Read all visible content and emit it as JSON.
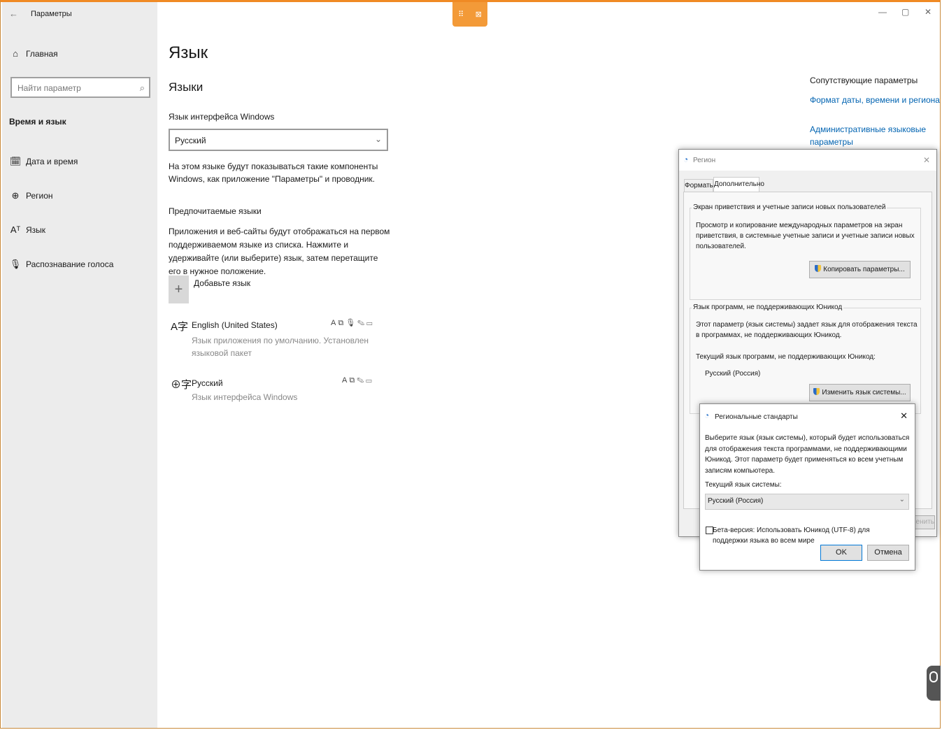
{
  "window": {
    "title": "Параметры",
    "back_glyph": "←",
    "minimize": "—",
    "maximize": "▢",
    "close": "✕"
  },
  "sidebar": {
    "home": "Главная",
    "search_placeholder": "Найти параметр",
    "section": "Время и язык",
    "items": [
      {
        "label": "Дата и время",
        "icon": "calendar-clock-icon",
        "glyph": "🗓"
      },
      {
        "label": "Регион",
        "icon": "globe-icon",
        "glyph": "⊕"
      },
      {
        "label": "Язык",
        "icon": "language-icon",
        "glyph": "Aᵀ"
      },
      {
        "label": "Распознавание голоса",
        "icon": "microphone-icon",
        "glyph": "🎙"
      }
    ]
  },
  "main": {
    "title": "Язык",
    "subtitle": "Языки",
    "interface_label": "Язык интерфейса Windows",
    "interface_value": "Русский",
    "interface_desc": "На этом языке будут показываться такие компоненты Windows, как приложение \"Параметры\" и проводник.",
    "preferred_label": "Предпочитаемые языки",
    "preferred_desc": "Приложения и веб-сайты будут отображаться на первом поддерживаемом языке из списка. Нажмите и удерживайте (или выберите) язык, затем перетащите его в нужное положение.",
    "add_language": "Добавьте язык",
    "languages": [
      {
        "name": "English (United States)",
        "desc": "Язык приложения по умолчанию. Установлен языковой пакет"
      },
      {
        "name": "Русский",
        "desc": "Язык интерфейса Windows"
      }
    ]
  },
  "related": {
    "title": "Сопутствующие параметры",
    "link1": "Формат даты, времени и региона",
    "link2": "Административные языковые параметры"
  },
  "region_dialog": {
    "title": "Регион",
    "tabs": [
      "Форматы",
      "Дополнительно"
    ],
    "group1_title": "Экран приветствия и учетные записи новых пользователей",
    "group1_text": "Просмотр и копирование международных параметров на экран приветствия, в системные учетные записи и учетные записи новых пользователей.",
    "copy_button": "Копировать параметры...",
    "group2_title": "Язык программ, не поддерживающих Юникод",
    "group2_text": "Этот параметр (язык системы) задает язык для отображения текста в программах, не поддерживающих Юникод.",
    "current_label": "Текущий язык программ, не поддерживающих Юникод:",
    "current_value": "Русский (Россия)",
    "change_button": "Изменить язык системы...",
    "apply_partial": "енить"
  },
  "regional_dialog": {
    "title": "Региональные стандарты",
    "text": "Выберите язык (язык системы), который будет использоваться для отображения текста программами, не поддерживающими Юникод. Этот параметр будет применяться ко всем учетным записям компьютера.",
    "current_label": "Текущий язык системы:",
    "select_value": "Русский (Россия)",
    "beta_label": "Бета-версия: Использовать Юникод (UTF-8) для поддержки языка во всем мире",
    "ok": "OK",
    "cancel": "Отмена"
  }
}
